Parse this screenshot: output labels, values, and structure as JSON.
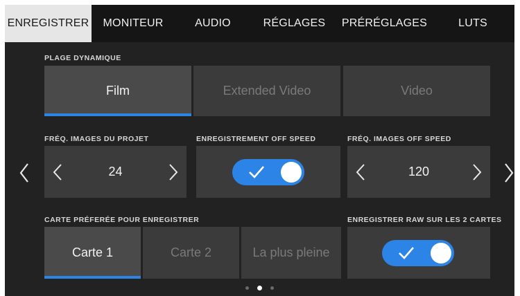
{
  "tabs": [
    "ENREGISTRER",
    "MONITEUR",
    "AUDIO",
    "RÉGLAGES",
    "PRÉRÉGLAGES",
    "LUTS"
  ],
  "active_tab": "ENREGISTRER",
  "dynamic_range": {
    "label": "PLAGE DYNAMIQUE",
    "options": [
      "Film",
      "Extended Video",
      "Video"
    ],
    "selected": "Film"
  },
  "project_fps": {
    "label": "FRÉQ. IMAGES DU PROJET",
    "value": "24"
  },
  "off_speed": {
    "label": "ENREGISTREMENT OFF SPEED",
    "enabled": true
  },
  "off_speed_fps": {
    "label": "FRÉQ. IMAGES OFF SPEED",
    "value": "120"
  },
  "preferred_card": {
    "label": "CARTE PRÉFERÉE POUR ENREGISTRER",
    "options": [
      "Carte 1",
      "Carte 2",
      "La plus pleine"
    ],
    "selected": "Carte 1"
  },
  "raw_both_cards": {
    "label": "ENREGISTRER RAW SUR LES 2 CARTES",
    "enabled": true
  },
  "pagination": {
    "pages": 3,
    "current": 2
  },
  "colors": {
    "accent": "#2c84e6",
    "background": "#222222",
    "tile": "#3b3b3b",
    "tab_active": "#e6e6e6"
  },
  "icons": [
    "chevron-left-icon",
    "chevron-right-icon",
    "checkmark-icon"
  ]
}
